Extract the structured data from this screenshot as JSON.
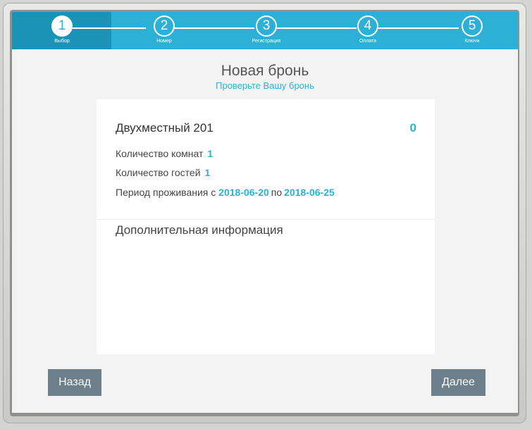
{
  "stepper": {
    "steps": [
      {
        "number": "1",
        "label": "Выбор"
      },
      {
        "number": "2",
        "label": "Номер"
      },
      {
        "number": "3",
        "label": "Регистрация"
      },
      {
        "number": "4",
        "label": "Оплата"
      },
      {
        "number": "5",
        "label": "Ключи"
      }
    ],
    "active_step": 1
  },
  "header": {
    "title": "Новая бронь",
    "subtitle": "Проверьте Вашу бронь"
  },
  "booking": {
    "room_name": "Двухместный 201",
    "price": "0",
    "rooms_label": "Количество комнат",
    "rooms_value": "1",
    "guests_label": "Количество гостей",
    "guests_value": "1",
    "period_label": "Период проживания с",
    "period_from": "2018-06-20",
    "period_to_label": "по",
    "period_to": "2018-06-25",
    "extra_title": "Дополнительная информация"
  },
  "buttons": {
    "back": "Назад",
    "next": "Далее"
  },
  "colors": {
    "accent": "#2db0d5",
    "active_step_bg": "#1b93b7",
    "button": "#6d7f8b"
  }
}
